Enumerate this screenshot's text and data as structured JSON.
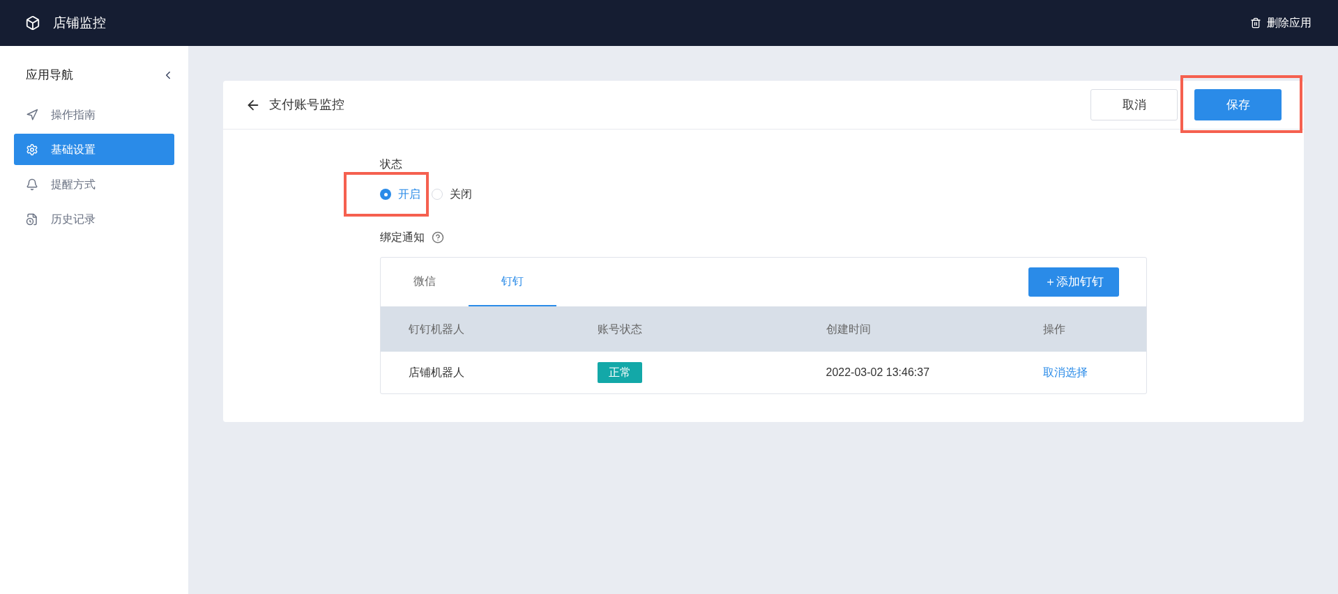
{
  "header": {
    "title": "店铺监控",
    "action": "删除应用"
  },
  "sidebar": {
    "title": "应用导航",
    "items": [
      {
        "label": "操作指南",
        "selected": false
      },
      {
        "label": "基础设置",
        "selected": true
      },
      {
        "label": "提醒方式",
        "selected": false
      },
      {
        "label": "历史记录",
        "selected": false
      }
    ]
  },
  "page": {
    "title": "支付账号监控",
    "buttons": [
      {
        "label": "取消",
        "kind": "secondary",
        "highlighted": false
      },
      {
        "label": "保存",
        "kind": "primary",
        "highlighted": true
      }
    ]
  },
  "status": {
    "label": "状态",
    "options": [
      {
        "label": "开启",
        "selected": true,
        "highlighted": true
      },
      {
        "label": "关闭",
        "selected": false,
        "highlighted": false
      }
    ]
  },
  "binding": {
    "label": "绑定通知",
    "tabs": [
      {
        "label": "微信",
        "selected": false
      },
      {
        "label": "钉钉",
        "selected": true
      }
    ],
    "add_button": "＋添加钉钉",
    "table": {
      "columns": [
        "钉钉机器人",
        "账号状态",
        "创建时间",
        "操作"
      ],
      "rows": [
        {
          "name": "店铺机器人",
          "status": "正常",
          "color": "#13a8a8",
          "created": "2022-03-02 13:46:37",
          "action": "取消选择"
        }
      ]
    }
  }
}
